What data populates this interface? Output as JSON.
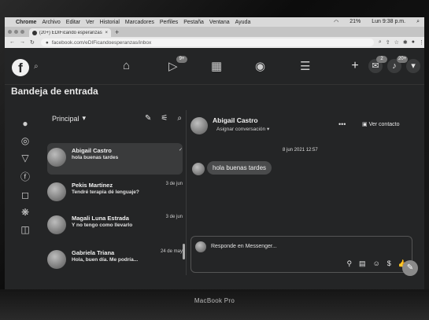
{
  "mac_menu": {
    "apple": "",
    "items": [
      "Chrome",
      "Archivo",
      "Editar",
      "Ver",
      "Historial",
      "Marcadores",
      "Perfiles",
      "Pestaña",
      "Ventana",
      "Ayuda"
    ],
    "battery": "21%",
    "clock": "Lun 9:38 p.m."
  },
  "browser": {
    "tab_title": "(20+) EDIFicando esperanzas | ",
    "url": "facebook.com/eDIFicandoesperanzas/inbox"
  },
  "fb_header": {
    "logo": "f",
    "badges": {
      "video": "9+",
      "messenger": "2",
      "notifications": "20+"
    }
  },
  "page": {
    "title": "Bandeja de entrada"
  },
  "list": {
    "filter_label": "Principal",
    "items": [
      {
        "name": "Abigail Castro",
        "message": "hola buenas tardes",
        "date": "✓"
      },
      {
        "name": "Pekis Martinez",
        "message": "Tendré terapia dé lenguaje?",
        "date": "3 de jun"
      },
      {
        "name": "Magali Luna Estrada",
        "message": "Y no tengo como llevarlo",
        "date": "3 de jun"
      },
      {
        "name": "Gabriela Triana",
        "message": "Hola, buen día. Me podría...",
        "date": "24 de may"
      }
    ]
  },
  "conversation": {
    "name": "Abigail Castro",
    "assign": "Asignar conversación",
    "view_contact": "Ver contacto",
    "timestamp": "8 jun 2021 12:57",
    "message": "hola buenas tardes",
    "composer_placeholder": "Responde en Messenger..."
  },
  "device": {
    "brand": "MacBook Pro"
  }
}
